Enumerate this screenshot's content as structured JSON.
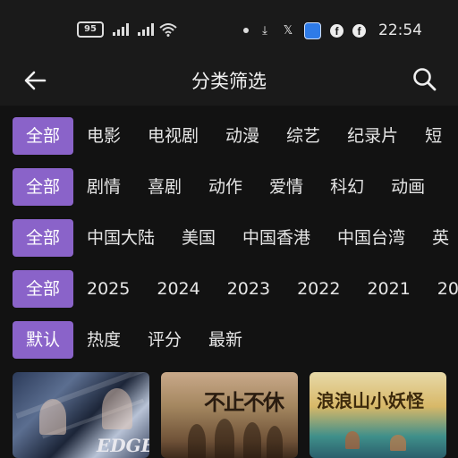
{
  "status_bar": {
    "battery": "95",
    "time": "22:54",
    "icons": [
      "signal-icon",
      "signal-icon",
      "wifi-icon",
      "dot-icon",
      "download-icon",
      "x-icon",
      "app-icon",
      "facebook-icon",
      "facebook-icon"
    ],
    "x_glyph": "𝕏",
    "download_glyph": "⤓",
    "fb_glyph": "f"
  },
  "header": {
    "title": "分类筛选",
    "back_icon": "arrow-left-icon",
    "search_icon": "search-icon"
  },
  "filters": [
    {
      "name": "type",
      "selected": "全部",
      "options": [
        "电影",
        "电视剧",
        "动漫",
        "综艺",
        "纪录片",
        "短"
      ]
    },
    {
      "name": "genre",
      "selected": "全部",
      "options": [
        "剧情",
        "喜剧",
        "动作",
        "爱情",
        "科幻",
        "动画"
      ]
    },
    {
      "name": "region",
      "selected": "全部",
      "options": [
        "中国大陆",
        "美国",
        "中国香港",
        "中国台湾",
        "英"
      ]
    },
    {
      "name": "year",
      "selected": "全部",
      "options": [
        "2025",
        "2024",
        "2023",
        "2022",
        "2021",
        "20"
      ]
    },
    {
      "name": "sort",
      "selected": "默认",
      "options": [
        "热度",
        "评分",
        "最新"
      ]
    }
  ],
  "posters": [
    {
      "text": "EDGE"
    },
    {
      "text": "不止不休"
    },
    {
      "text": "浪浪山小妖怪"
    }
  ],
  "colors": {
    "accent": "#8a63c9",
    "background": "#121212",
    "bar": "#1a1a1a"
  }
}
